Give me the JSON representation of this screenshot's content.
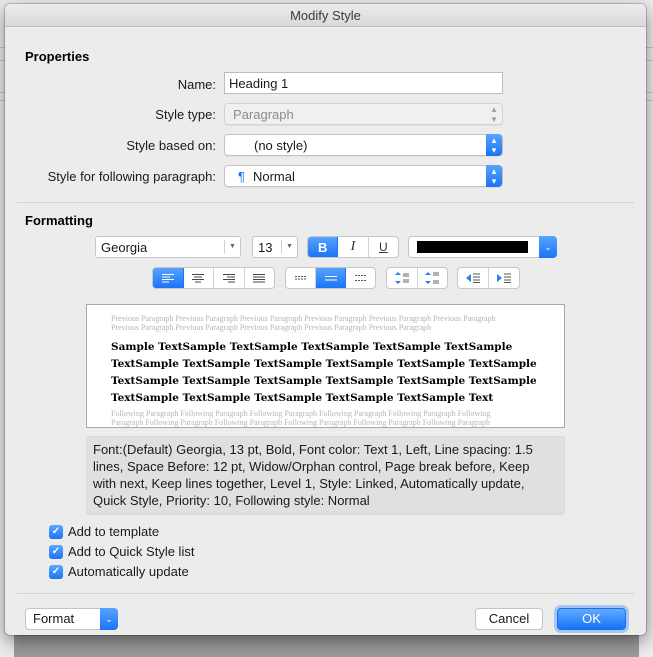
{
  "dialog": {
    "title": "Modify Style"
  },
  "properties": {
    "heading": "Properties",
    "name_label": "Name:",
    "name_value": "Heading 1",
    "style_type_label": "Style type:",
    "style_type_value": "Paragraph",
    "based_on_label": "Style based on:",
    "based_on_value": "(no style)",
    "following_label": "Style for following paragraph:",
    "following_icon": "¶",
    "following_value": "Normal"
  },
  "formatting": {
    "heading": "Formatting",
    "font_name": "Georgia",
    "font_size": "13",
    "bold_label": "B",
    "italic_label": "I",
    "underline_label": "U",
    "bold_active": true,
    "italic_active": false,
    "underline_active": false,
    "font_color": "#000000",
    "alignment_selected": "left",
    "line_spacing_selected": "1.5",
    "alignment_buttons": [
      "align-left",
      "align-center",
      "align-right",
      "justify"
    ],
    "spacing_buttons": [
      "single-spacing",
      "one-and-half-spacing",
      "double-spacing"
    ],
    "paragraph_spacing_buttons": [
      "decrease-paragraph-spacing",
      "increase-paragraph-spacing"
    ],
    "indent_buttons": [
      "decrease-indent",
      "increase-indent"
    ]
  },
  "preview": {
    "previous_paragraph": "Previous Paragraph Previous Paragraph Previous Paragraph Previous Paragraph Previous Paragraph Previous Paragraph Previous Paragraph Previous Paragraph Previous Paragraph Previous Paragraph Previous Paragraph",
    "sample_lines": [
      "Sample TextSample TextSample TextSample TextSample TextSample",
      "TextSample TextSample TextSample TextSample TextSample TextSample",
      "TextSample TextSample TextSample TextSample TextSample TextSample",
      "TextSample TextSample TextSample TextSample TextSample Text"
    ],
    "following_paragraph": "Following Paragraph Following Paragraph Following Paragraph Following Paragraph Following Paragraph Following Paragraph Following Paragraph Following Paragraph Following Paragraph Following Paragraph Following Paragraph"
  },
  "description": "Font:(Default) Georgia, 13 pt, Bold, Font color: Text 1, Left, Line spacing: 1.5 lines, Space Before:  12 pt, Widow/Orphan control, Page break before, Keep with next, Keep lines together, Level 1, Style: Linked, Automatically update, Quick Style, Priority: 10, Following style: Normal",
  "options": [
    {
      "label": "Add to template",
      "checked": true
    },
    {
      "label": "Add to Quick Style list",
      "checked": true
    },
    {
      "label": "Automatically update",
      "checked": true
    }
  ],
  "footer": {
    "format_label": "Format",
    "cancel_label": "Cancel",
    "ok_label": "OK"
  }
}
